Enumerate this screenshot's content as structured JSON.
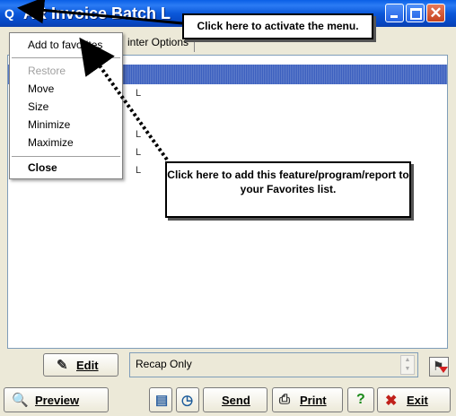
{
  "window": {
    "title": "AR Invoice Batch L",
    "icon": "q-icon",
    "controls": [
      "minimize-icon",
      "maximize-icon",
      "close-icon"
    ],
    "close_glyph": "✕"
  },
  "tab": {
    "label": "inter Options"
  },
  "list": {
    "line_char": "L"
  },
  "system_menu": {
    "items": [
      {
        "label": "Add to favorites",
        "state": "normal"
      },
      {
        "label": "Restore",
        "state": "disabled"
      },
      {
        "label": "Move",
        "state": "normal"
      },
      {
        "label": "Size",
        "state": "normal"
      },
      {
        "label": "Minimize",
        "state": "normal"
      },
      {
        "label": "Maximize",
        "state": "normal"
      },
      {
        "label": "Close",
        "state": "bold"
      }
    ]
  },
  "callouts": {
    "menu": "Click here to activate the menu.",
    "favorites": "Click here to add this feature/program/report to your Favorites list."
  },
  "edit_row": {
    "edit_label": "Edit",
    "recap_text": "Recap Only"
  },
  "bottom_bar": {
    "preview_label": "Preview",
    "send_label": "Send",
    "print_label": "Print",
    "help_glyph": "?",
    "exit_label": "Exit"
  },
  "colors": {
    "titlebar": "#0b58d9",
    "selection": "#3b5fbf",
    "help": "#1a8a1a",
    "exit": "#c0201a"
  }
}
